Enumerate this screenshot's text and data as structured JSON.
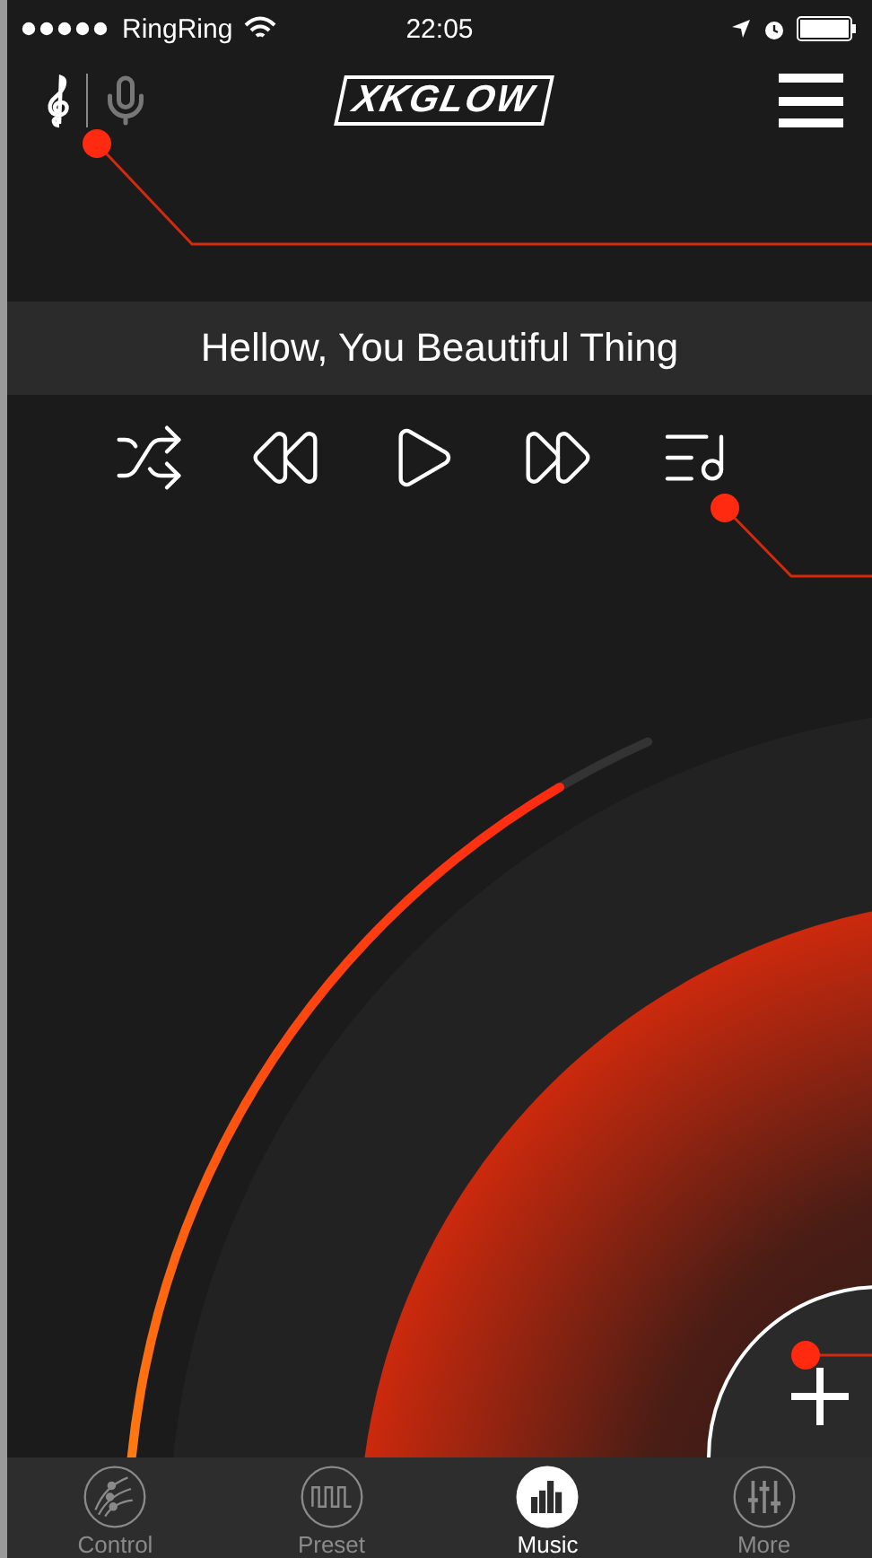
{
  "status_bar": {
    "carrier": "RingRing",
    "time": "22:05"
  },
  "header": {
    "logo": "XKGLOW",
    "input_modes": [
      {
        "kind": "music",
        "selected": true
      },
      {
        "kind": "mic",
        "selected": false
      }
    ]
  },
  "now_playing": {
    "title": "Hellow, You Beautiful Thing"
  },
  "transport": [
    {
      "kind": "shuffle"
    },
    {
      "kind": "rewind"
    },
    {
      "kind": "play"
    },
    {
      "kind": "forward"
    },
    {
      "kind": "playlist"
    }
  ],
  "progress": {
    "level": 0.91
  },
  "tabs": [
    {
      "label": "Control",
      "kind": "control",
      "selected": false
    },
    {
      "label": "Preset",
      "kind": "preset",
      "selected": false
    },
    {
      "label": "Music",
      "kind": "music",
      "selected": true
    },
    {
      "label": "More",
      "kind": "more",
      "selected": false
    }
  ]
}
